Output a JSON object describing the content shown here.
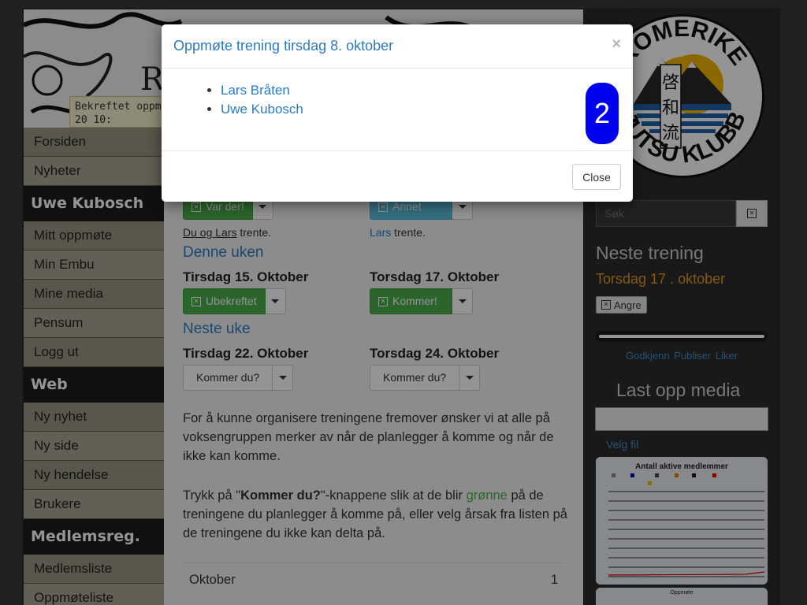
{
  "banner": {
    "title_fragment": "Ro",
    "note": "Bekreftet oppmøte 20 10:"
  },
  "sidebar": {
    "items_top": [
      {
        "label": "Forsiden",
        "name": "sidebar-item-forsiden"
      },
      {
        "label": "Nyheter",
        "name": "sidebar-item-nyheter"
      }
    ],
    "user_header": "Uwe Kubosch",
    "user_items": [
      {
        "label": "Mitt oppmøte",
        "name": "sidebar-item-mitt-oppmote"
      },
      {
        "label": "Min Embu",
        "name": "sidebar-item-min-embu"
      },
      {
        "label": "Mine media",
        "name": "sidebar-item-mine-media"
      },
      {
        "label": "Pensum",
        "name": "sidebar-item-pensum"
      },
      {
        "label": "Logg ut",
        "name": "sidebar-item-logg-ut"
      }
    ],
    "web_header": "Web",
    "web_items": [
      {
        "label": "Ny nyhet",
        "name": "sidebar-item-ny-nyhet"
      },
      {
        "label": "Ny side",
        "name": "sidebar-item-ny-side"
      },
      {
        "label": "Ny hendelse",
        "name": "sidebar-item-ny-hendelse"
      },
      {
        "label": "Brukere",
        "name": "sidebar-item-brukere"
      }
    ],
    "reg_header": "Medlemsreg.",
    "reg_items": [
      {
        "label": "Medlemsliste",
        "name": "sidebar-item-medlemsliste"
      },
      {
        "label": "Oppmøteliste",
        "name": "sidebar-item-oppmoteliste"
      }
    ]
  },
  "main": {
    "prev": {
      "left_button": "Var der!",
      "left_trent_link": "Du og Lars",
      "left_trent_suffix": " trente.",
      "right_button": "Annet",
      "right_trent_link": "Lars",
      "right_trent_suffix": " trente."
    },
    "this_week": {
      "heading": "Denne uken",
      "left_day": "Tirsdag 15. Oktober",
      "left_button": "Ubekreftet",
      "right_day": "Torsdag 17. Oktober",
      "right_button": "Kommer!"
    },
    "next_week": {
      "heading": "Neste uke",
      "left_day": "Tirsdag 22. Oktober",
      "left_button": "Kommer du?",
      "right_day": "Torsdag 24. Oktober",
      "right_button": "Kommer du?"
    },
    "para1": "For å kunne organisere treningene fremover ønsker vi at alle på voksengruppen merker av når de planlegger å komme og når de ikke kan komme.",
    "para2_a": "Trykk på \"",
    "para2_bold": "Kommer du?",
    "para2_b": "\"-knappene slik at de blir ",
    "para2_green": "grønne",
    "para2_c": " på de treningene du planlegger å komme på, eller velg årsak fra listen på de treningene du ikke kan delta på.",
    "month_label": "Oktober",
    "month_value": "1"
  },
  "right": {
    "logo_text_top": "ROMERIKE",
    "logo_text_bottom": "JUTSU KLUBB",
    "logo_kanji": [
      "啓",
      "和",
      "流"
    ],
    "search_placeholder": "Søk",
    "next_training_title": "Neste trening",
    "next_training_day": "Torsdag 17 . oktober",
    "angre_label": "Angre",
    "action_links": "Godkjenn Publiser Liker",
    "upload_title": "Last opp media",
    "velg_fil": "Velg fil",
    "mini_chart_title": "Antall aktive medlemmer",
    "mini_chart_2_title": "Oppmøte"
  },
  "modal": {
    "title": "Oppmøte trening tirsdag 8. oktober",
    "close_x": "×",
    "attendees": [
      "Lars Bråten",
      "Uwe Kubosch"
    ],
    "count": "2",
    "close_label": "Close"
  },
  "colors": {
    "accent_link": "#2a7bc0",
    "success_green": "#4cae4c",
    "info_blue": "#5bc0de",
    "badge_blue": "#0000f0",
    "orange": "#e59a1c"
  }
}
